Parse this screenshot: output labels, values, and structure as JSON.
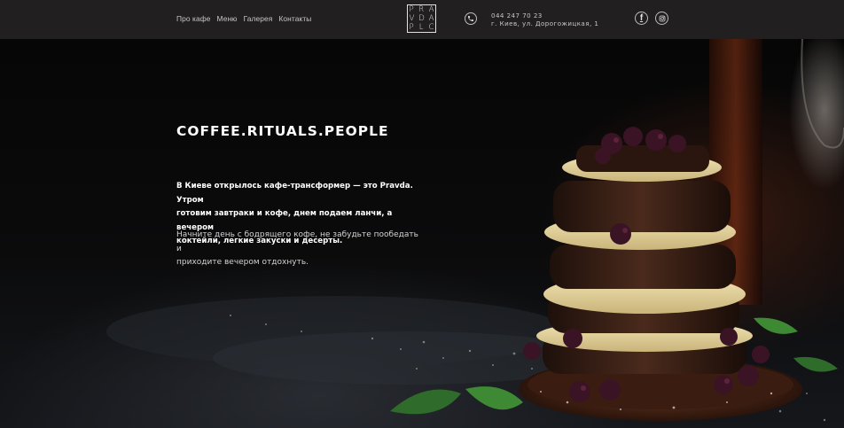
{
  "nav": {
    "items": [
      {
        "label": "Про кафе"
      },
      {
        "label": "Меню"
      },
      {
        "label": "Галерея"
      },
      {
        "label": "Контакты"
      }
    ]
  },
  "logo": {
    "rows": [
      [
        "P",
        "R",
        "A"
      ],
      [
        "V",
        "D",
        "A"
      ],
      [
        "P",
        "L",
        "C"
      ]
    ]
  },
  "contact": {
    "phone": "044 247 70 23",
    "address": "г. Киев, ул. Дорогожицкая, 1",
    "phone_icon": "phone-icon"
  },
  "social": {
    "facebook_icon": "facebook-icon",
    "instagram_icon": "instagram-icon"
  },
  "hero": {
    "title": "COFFEE.RITUALS.PEOPLE",
    "lead": "В Киеве открылось кафе-трансформер — это Pravda. Утром\nготовим завтраки и кофе, днем подаем ланчи, а вечером\nкоктейли, легкие закуски и десерты.",
    "text": "Начните день с бодрящего кофе, не забудьте пообедать и\nприходите вечером отдохнуть."
  },
  "colors": {
    "header_bg": "#221f20",
    "hero_bg": "#060606",
    "cream": "#efe0ad",
    "cake": "#3a2218",
    "berry": "#2a1220"
  }
}
